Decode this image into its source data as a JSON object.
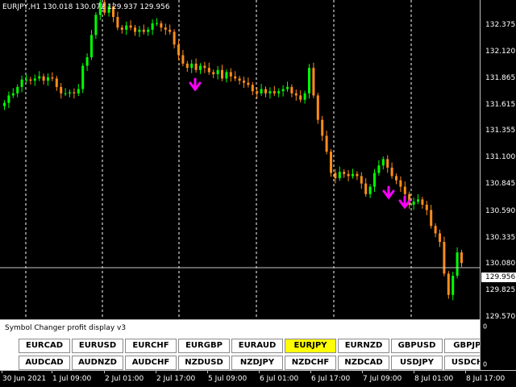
{
  "chart": {
    "symbol_header": "EURJPY,H1  130.018 130.072 129.937 129.956",
    "current_price": "129.956",
    "price_levels": [
      "132.375",
      "132.120",
      "131.865",
      "131.615",
      "131.355",
      "131.100",
      "130.845",
      "130.590",
      "130.335",
      "130.080",
      "129.825",
      "129.570"
    ],
    "colors": {
      "bull": "#00ff00",
      "bear": "#ff8c1a",
      "arrow": "#ff00ff",
      "grid": "#ffffff"
    }
  },
  "indicator": {
    "title": "Symbol Changer profit display v3",
    "axis_top": "0",
    "axis_bottom": "0",
    "row1": [
      "EURCAD",
      "EURUSD",
      "EURCHF",
      "EURGBP",
      "EURAUD",
      "EURJPY",
      "EURNZD",
      "GBPUSD",
      "GBPJPY"
    ],
    "row2": [
      "AUDCAD",
      "AUDNZD",
      "AUDCHF",
      "NZDUSD",
      "NZDJPY",
      "NZDCHF",
      "NZDCAD",
      "USDJPY",
      "USDCHF"
    ],
    "active_symbol": "EURJPY"
  },
  "time_axis": [
    "30 Jun 2021",
    "1 Jul 09:00",
    "2 Jul 01:00",
    "2 Jul 17:00",
    "5 Jul 09:00",
    "6 Jul 01:00",
    "6 Jul 17:00",
    "7 Jul 09:00",
    "8 Jul 01:00",
    "8 Jul 17:00"
  ],
  "chart_data": {
    "type": "candlestick",
    "title": "EURJPY,H1",
    "ylim": [
      129.47,
      132.48
    ],
    "current_price": 129.956,
    "signal_arrows": "three magenta down arrows",
    "closes": [
      131.51,
      131.58,
      131.6,
      131.66,
      131.73,
      131.73,
      131.72,
      131.74,
      131.76,
      131.72,
      131.75,
      131.74,
      131.66,
      131.6,
      131.6,
      131.61,
      131.6,
      131.64,
      131.86,
      131.94,
      132.15,
      132.34,
      132.46,
      132.36,
      132.42,
      132.32,
      132.22,
      132.2,
      132.24,
      132.22,
      132.18,
      132.2,
      132.18,
      132.2,
      132.26,
      132.26,
      132.22,
      132.2,
      132.18,
      132.06,
      131.96,
      131.88,
      131.84,
      131.88,
      131.82,
      131.86,
      131.84,
      131.8,
      131.78,
      131.82,
      131.74,
      131.8,
      131.76,
      131.74,
      131.72,
      131.7,
      131.68,
      131.62,
      131.6,
      131.64,
      131.6,
      131.62,
      131.6,
      131.62,
      131.64,
      131.66,
      131.6,
      131.58,
      131.54,
      131.6,
      131.84,
      131.58,
      131.35,
      131.2,
      131.05,
      130.85,
      130.8,
      130.86,
      130.84,
      130.82,
      130.84,
      130.82,
      130.75,
      130.65,
      130.72,
      130.85,
      130.92,
      130.98,
      130.9,
      130.82,
      130.78,
      130.72,
      130.65,
      130.55,
      130.58,
      130.6,
      130.55,
      130.5,
      130.35,
      130.28,
      130.2,
      129.9,
      129.7,
      129.88,
      130.1,
      130.0
    ]
  }
}
